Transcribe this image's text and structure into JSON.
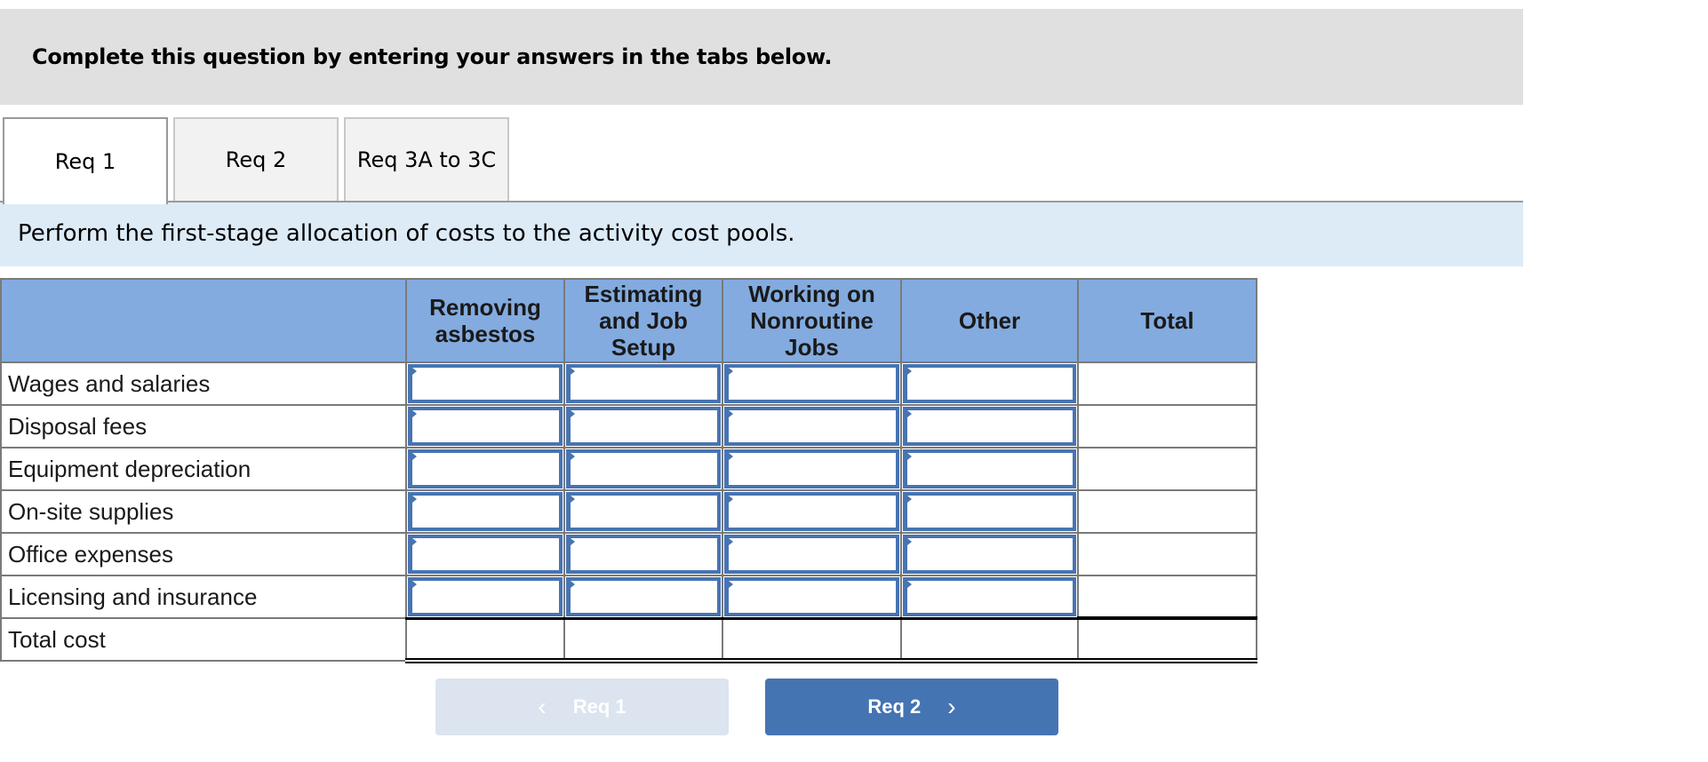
{
  "banner": {
    "text": "Complete this question by entering your answers in the tabs below."
  },
  "tabs": [
    {
      "label": "Req 1",
      "active": true
    },
    {
      "label": "Req 2",
      "active": false
    },
    {
      "label": "Req 3A to 3C",
      "active": false
    }
  ],
  "instruction": "Perform the first-stage allocation of costs to the activity cost pools.",
  "table": {
    "columns": [
      "",
      "Removing asbestos",
      "Estimating and Job Setup",
      "Working on Nonroutine Jobs",
      "Other",
      "Total"
    ],
    "rows": [
      {
        "label": "Wages and salaries",
        "values": [
          "",
          "",
          "",
          ""
        ],
        "total": ""
      },
      {
        "label": "Disposal fees",
        "values": [
          "",
          "",
          "",
          ""
        ],
        "total": ""
      },
      {
        "label": "Equipment depreciation",
        "values": [
          "",
          "",
          "",
          ""
        ],
        "total": ""
      },
      {
        "label": "On-site supplies",
        "values": [
          "",
          "",
          "",
          ""
        ],
        "total": ""
      },
      {
        "label": "Office expenses",
        "values": [
          "",
          "",
          "",
          ""
        ],
        "total": ""
      },
      {
        "label": "Licensing and insurance",
        "values": [
          "",
          "",
          "",
          ""
        ],
        "total": ""
      }
    ],
    "total_row": {
      "label": "Total cost",
      "values": [
        "",
        "",
        "",
        "",
        ""
      ]
    }
  },
  "nav": {
    "prev": {
      "label": "Req 1",
      "icon": "chevron-left-icon",
      "glyph": "‹",
      "disabled": true
    },
    "next": {
      "label": "Req 2",
      "icon": "chevron-right-icon",
      "glyph": "›",
      "disabled": false
    }
  },
  "colors": {
    "header_blue": "#83abdf",
    "input_border": "#4774b3",
    "instruction_bg": "#ddebf7",
    "banner_bg": "#e0e0e0",
    "next_button": "#4574b3",
    "prev_button_disabled": "#dbe4ef"
  }
}
